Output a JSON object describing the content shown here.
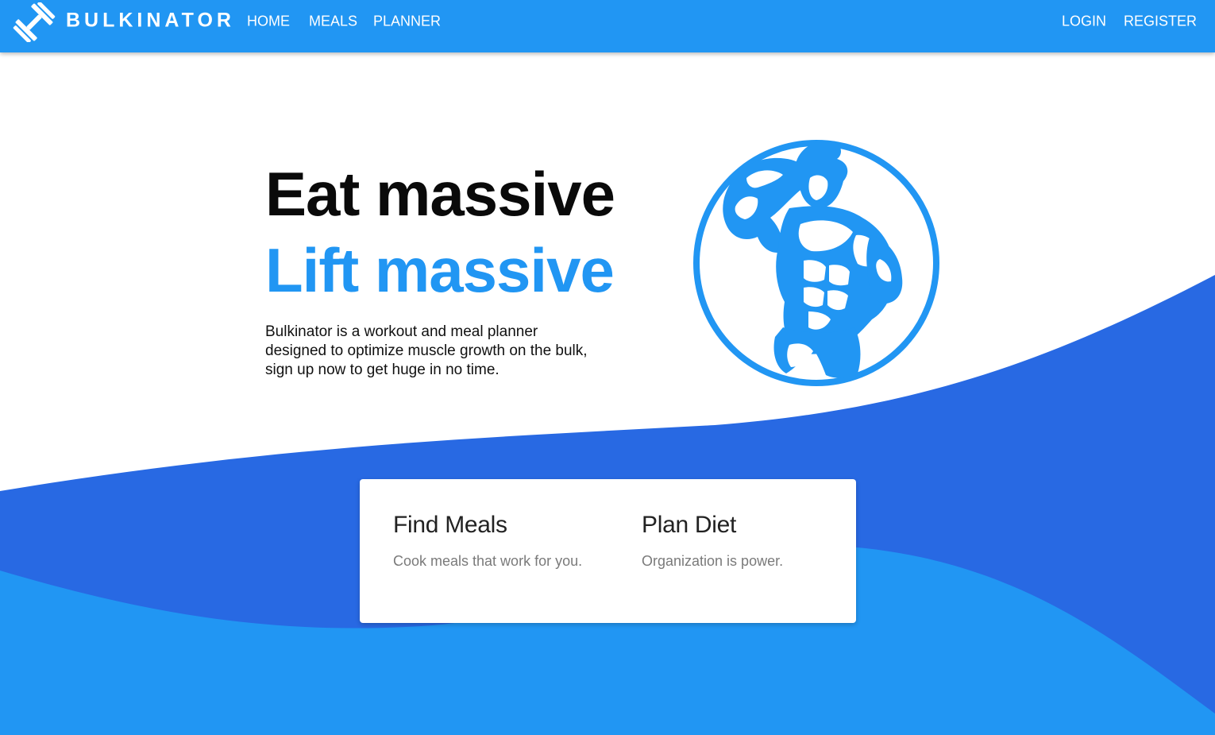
{
  "brand": {
    "name": "BULKINATOR",
    "icon": "dumbbell-icon"
  },
  "nav": {
    "left": [
      "HOME",
      "MEALS",
      "PLANNER"
    ],
    "right": [
      "LOGIN",
      "REGISTER"
    ]
  },
  "hero": {
    "headline_1": "Eat massive",
    "headline_2": "Lift massive",
    "description": "Bulkinator is a workout and meal planner designed to optimize muscle growth on the bulk, sign up now to get huge in no time.",
    "illustration": "bodybuilder-icon"
  },
  "features": [
    {
      "title": "Find Meals",
      "description": "Cook meals that work for you."
    },
    {
      "title": "Plan Diet",
      "description": "Organization is power."
    }
  ],
  "colors": {
    "primary": "#2196f3",
    "wave_dark": "#2869e3",
    "wave_light": "#2196f3",
    "card": "#ffffff"
  }
}
